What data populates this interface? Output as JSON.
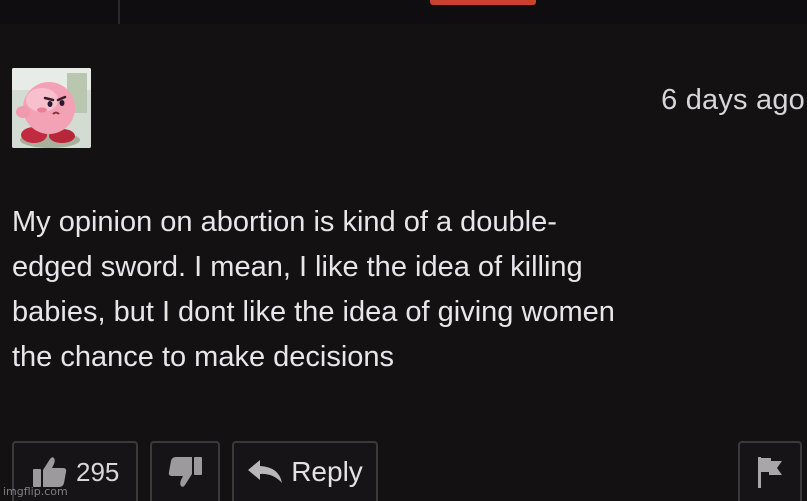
{
  "comment": {
    "timestamp": "6 days ago",
    "lines": [
      "My opinion on abortion is kind of a double-",
      "edged sword. I mean, I like the idea of killing",
      "babies, but I dont like the idea of giving women",
      "the chance to make decisions"
    ]
  },
  "actions": {
    "like_count": "295",
    "reply_label": "Reply",
    "icons": {
      "like": "thumbs-up-icon",
      "dislike": "thumbs-down-icon",
      "reply": "reply-arrow-icon",
      "flag": "flag-icon"
    }
  },
  "avatar": {
    "icon": "kirby-avatar"
  },
  "watermark": "imgflip.com",
  "colors": {
    "background": "#141113",
    "text": "#e8e6e8",
    "button_border": "#3b393b",
    "accent": "#c8422f"
  }
}
